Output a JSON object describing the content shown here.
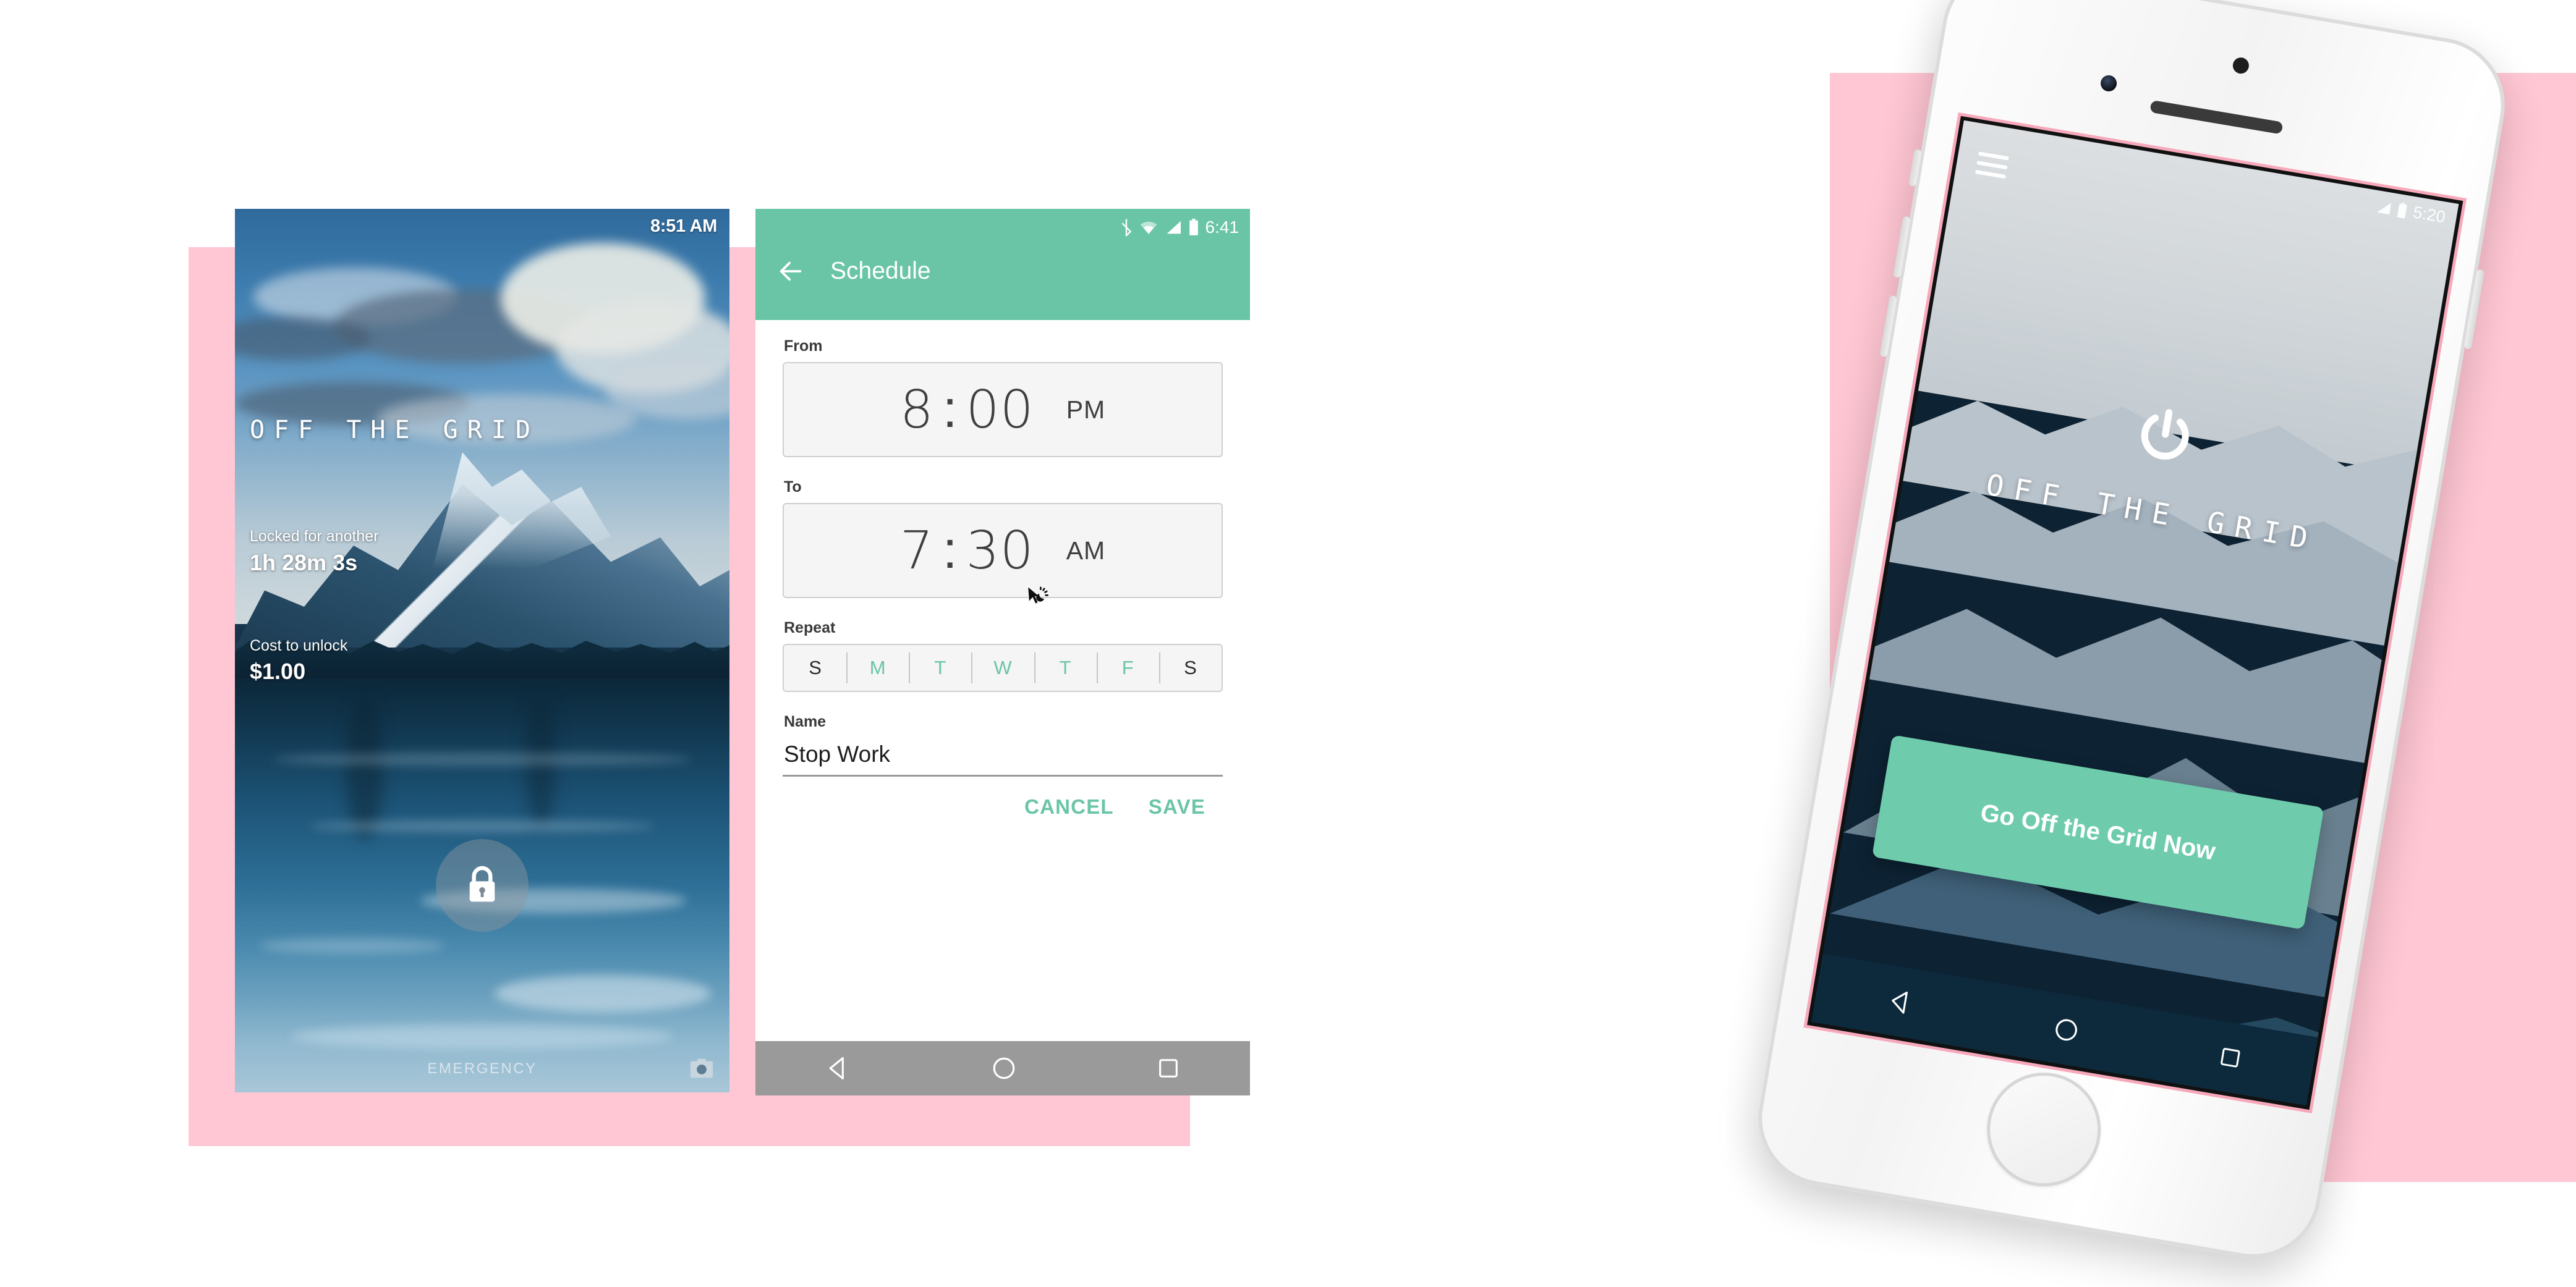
{
  "palette": {
    "pink_plate": "#FFC6D3",
    "accent_green": "#6AC5A6",
    "cta_green": "#6ECCAC",
    "nav_gray": "#9A9A9A",
    "page_bg": "#FFFFFF"
  },
  "lock_screen": {
    "status_time": "8:51 AM",
    "brand": "OFF THE GRID",
    "locked_label": "Locked for another",
    "locked_value": "1h 28m 3s",
    "cost_label": "Cost to unlock",
    "cost_value": "$1.00",
    "lock_icon": "lock-icon",
    "emergency_label": "EMERGENCY",
    "camera_icon": "camera-icon"
  },
  "schedule_app": {
    "status_bar": {
      "time": "6:41",
      "icons": [
        "bluetooth-icon",
        "wifi-icon",
        "signal-icon",
        "battery-icon"
      ]
    },
    "back_icon": "arrow-back-icon",
    "title": "Schedule",
    "from": {
      "label": "From",
      "hour": "8",
      "separator": ":",
      "minute": "00",
      "meridiem": "PM"
    },
    "to": {
      "label": "To",
      "hour": "7",
      "separator": ":",
      "minute": "30",
      "meridiem": "AM"
    },
    "repeat": {
      "label": "Repeat",
      "days": [
        {
          "letter": "S",
          "selected": false
        },
        {
          "letter": "M",
          "selected": true
        },
        {
          "letter": "T",
          "selected": true
        },
        {
          "letter": "W",
          "selected": true
        },
        {
          "letter": "T",
          "selected": true
        },
        {
          "letter": "F",
          "selected": true
        },
        {
          "letter": "S",
          "selected": false
        }
      ]
    },
    "name": {
      "label": "Name",
      "value": "Stop Work",
      "placeholder": "Name"
    },
    "cancel_label": "CANCEL",
    "save_label": "SAVE",
    "nav_bar": [
      "back-nav-icon",
      "home-nav-icon",
      "recents-nav-icon"
    ]
  },
  "cursor": {
    "icon": "busy-cursor-icon"
  },
  "device_screen": {
    "status_bar": {
      "time": "5:20",
      "icons": [
        "signal-icon",
        "battery-icon"
      ]
    },
    "menu_icon": "hamburger-menu-icon",
    "power_icon": "power-icon",
    "brand": "OFF THE GRID",
    "cta_label": "Go Off the Grid Now",
    "nav_bar": [
      "back-nav-icon",
      "home-nav-icon",
      "recents-nav-icon"
    ]
  },
  "device": {
    "camera_icon": "front-camera-icon",
    "sensor_icon": "proximity-sensor-icon",
    "speaker_icon": "earpiece-speaker-icon",
    "home_button": "home-button"
  }
}
